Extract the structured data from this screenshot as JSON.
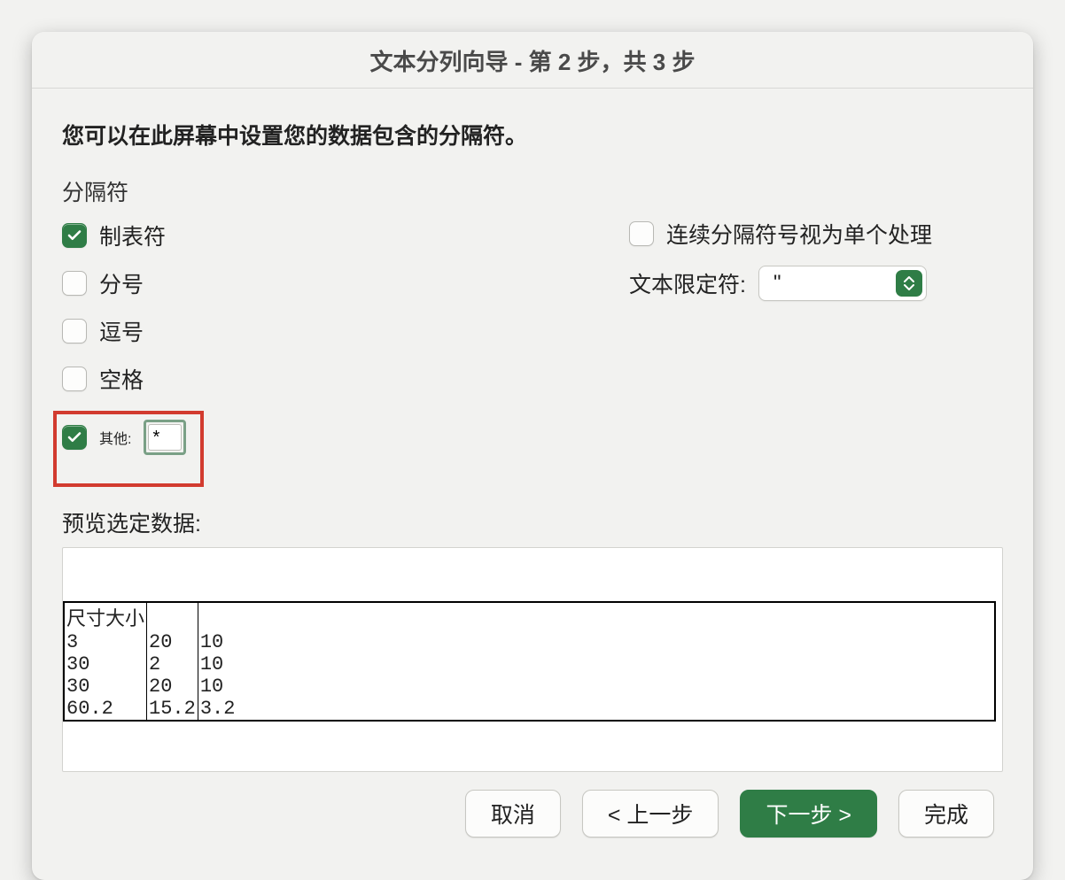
{
  "title": "文本分列向导 - 第 2 步，共 3 步",
  "instruction": "您可以在此屏幕中设置您的数据包含的分隔符。",
  "delimiters": {
    "label": "分隔符",
    "tab": {
      "label": "制表符",
      "checked": true
    },
    "semicolon": {
      "label": "分号",
      "checked": false
    },
    "comma": {
      "label": "逗号",
      "checked": false
    },
    "space": {
      "label": "空格",
      "checked": false
    },
    "other": {
      "label": "其他:",
      "checked": true,
      "value": "*"
    }
  },
  "treat_consecutive": {
    "label": "连续分隔符号视为单个处理",
    "checked": false
  },
  "text_qualifier": {
    "label": "文本限定符:",
    "value": "\""
  },
  "preview": {
    "label": "预览选定数据:",
    "columns": 3,
    "rows": [
      [
        "尺寸大小",
        "",
        ""
      ],
      [
        "3",
        "20",
        "10"
      ],
      [
        "30",
        "2",
        "10"
      ],
      [
        "30",
        "20",
        "10"
      ],
      [
        "60.2",
        "15.2",
        "3.2"
      ]
    ]
  },
  "buttons": {
    "cancel": "取消",
    "back": "< 上一步",
    "next": "下一步 >",
    "finish": "完成"
  },
  "colors": {
    "accent": "#2f7d46",
    "highlight_border": "#d23b2f"
  }
}
